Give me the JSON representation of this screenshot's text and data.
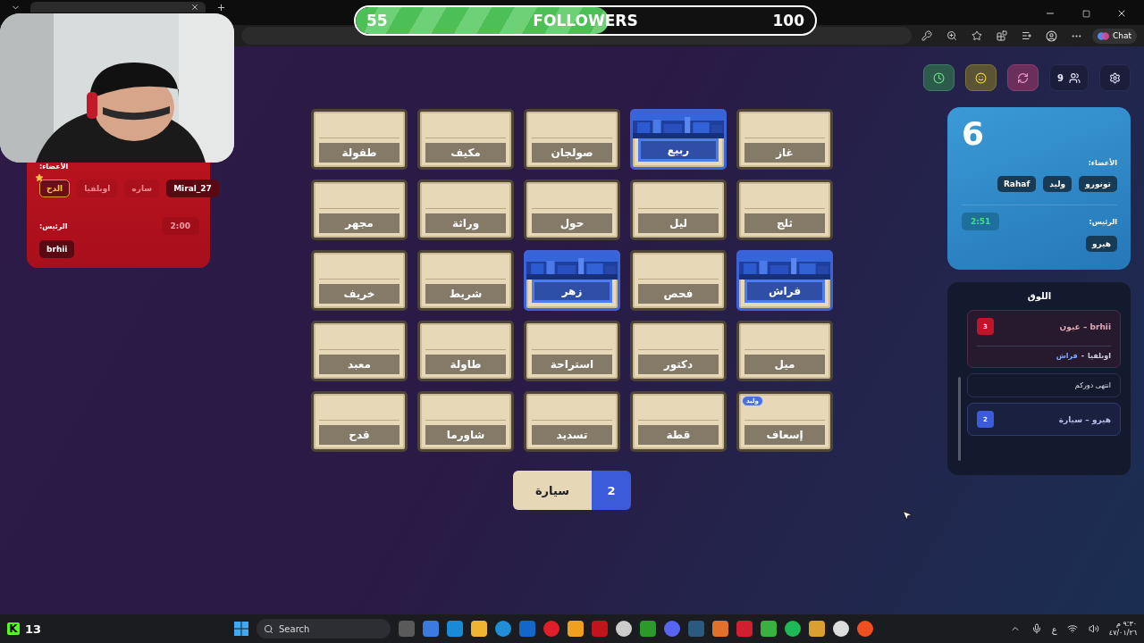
{
  "browser": {
    "chat_button": "Chat"
  },
  "followers": {
    "current": "55",
    "label": "FOLLOWERS",
    "goal": "100",
    "level": 0.55
  },
  "red_team": {
    "members_label": "الأعضاء:",
    "members": [
      {
        "name": "Miral_27",
        "active": true,
        "starred": false
      },
      {
        "name": "ساره",
        "active": false,
        "starred": false
      },
      {
        "name": "اوبلفيا",
        "active": false,
        "starred": false
      },
      {
        "name": "الدح",
        "active": true,
        "starred": true
      }
    ],
    "leader_label": "الرئيس:",
    "timer": {
      "text": "2:00",
      "active": false
    },
    "leader": "brhii"
  },
  "toolbar": {
    "players_count": "9"
  },
  "blue_team": {
    "score": "6",
    "members_label": "الأعضاء:",
    "members": [
      {
        "name": "تونورو",
        "active": true
      },
      {
        "name": "وليد",
        "active": true
      },
      {
        "name": "Rahaf",
        "active": true
      }
    ],
    "leader_label": "الرئيس:",
    "timer": {
      "text": "2:51",
      "active": true
    },
    "leader": "هيرو"
  },
  "board": {
    "cards": [
      {
        "word": "غاز",
        "revealed": false
      },
      {
        "word": "ربيع",
        "revealed": true
      },
      {
        "word": "صولجان",
        "revealed": false
      },
      {
        "word": "مكيف",
        "revealed": false
      },
      {
        "word": "طفولة",
        "revealed": false
      },
      {
        "word": "ثلج",
        "revealed": false
      },
      {
        "word": "ليل",
        "revealed": false
      },
      {
        "word": "حول",
        "revealed": false
      },
      {
        "word": "وراثة",
        "revealed": false
      },
      {
        "word": "مجهر",
        "revealed": false
      },
      {
        "word": "فراش",
        "revealed": true
      },
      {
        "word": "فحص",
        "revealed": false
      },
      {
        "word": "زهر",
        "revealed": true
      },
      {
        "word": "شريط",
        "revealed": false
      },
      {
        "word": "خريف",
        "revealed": false
      },
      {
        "word": "ميل",
        "revealed": false
      },
      {
        "word": "دكتور",
        "revealed": false
      },
      {
        "word": "استراحة",
        "revealed": false
      },
      {
        "word": "طاولة",
        "revealed": false
      },
      {
        "word": "معبد",
        "revealed": false
      },
      {
        "word": "إسعاف",
        "revealed": false,
        "votes": [
          "وليد"
        ]
      },
      {
        "word": "قطة",
        "revealed": false
      },
      {
        "word": "تسديد",
        "revealed": false
      },
      {
        "word": "شاورما",
        "revealed": false
      },
      {
        "word": "قدح",
        "revealed": false
      }
    ]
  },
  "clue": {
    "word": "سيارة",
    "count": "2"
  },
  "log": {
    "title": "اللوق",
    "entries": [
      {
        "kind": "clue",
        "text": "brhii – عيون",
        "count": "3",
        "color": "#c0142a",
        "guess": {
          "player": "اوبلفيا",
          "separator": "-",
          "word": "فراش"
        }
      },
      {
        "kind": "notice",
        "text": "انتهى دوركم"
      },
      {
        "kind": "clue",
        "text": "هيرو – سيارة",
        "count": "2",
        "color": "#3b5bdb"
      }
    ]
  },
  "stream_overlay": {
    "logo": "K",
    "viewers": "13"
  },
  "taskbar": {
    "search_placeholder": "Search",
    "language": "ع",
    "time": "٩:٣٠ م",
    "date": "٤٧/٠١/٢٦"
  }
}
